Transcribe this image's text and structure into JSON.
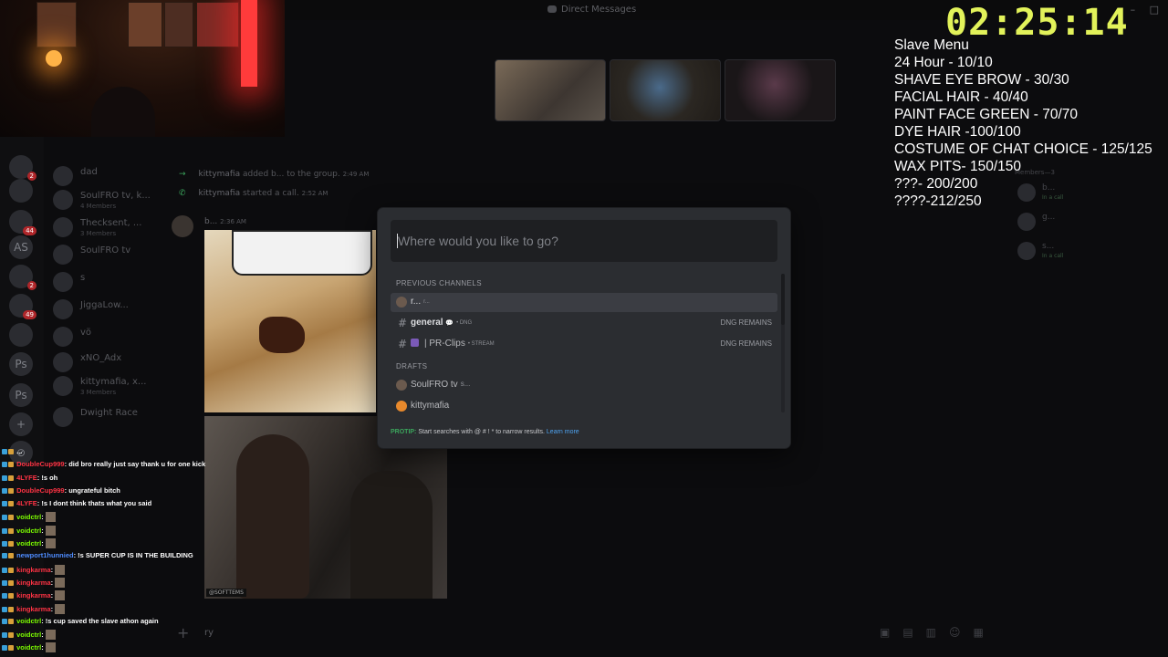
{
  "window": {
    "title": "Direct Messages",
    "controls": [
      "–",
      "□"
    ]
  },
  "timer": {
    "text": "02:25:14",
    "color": "#e2f25a"
  },
  "slave_menu": {
    "title": "Slave Menu",
    "items": [
      "24 Hour - 10/10",
      "SHAVE EYE BROW - 30/30",
      "FACIAL HAIR - 40/40",
      "PAINT FACE GREEN - 70/70",
      "DYE HAIR -100/100",
      "COSTUME OF CHAT CHOICE - 125/125",
      "WAX PITS- 150/150",
      "???- 200/200",
      "????-212/250"
    ]
  },
  "servers": [
    {
      "label": "",
      "badge": "2"
    },
    {
      "label": "",
      "badge": ""
    },
    {
      "label": "",
      "badge": "44"
    },
    {
      "label": "AS",
      "badge": ""
    },
    {
      "label": "",
      "badge": "2"
    },
    {
      "label": "",
      "badge": "49"
    },
    {
      "label": "",
      "badge": ""
    },
    {
      "label": "Ps",
      "badge": ""
    },
    {
      "label": "Ps",
      "badge": ""
    },
    {
      "label": "+",
      "badge": ""
    },
    {
      "label": "⊘",
      "badge": ""
    }
  ],
  "dm_list": [
    {
      "name": "dad",
      "sub": ""
    },
    {
      "name": "SoulFRO tv, k...",
      "sub": "4 Members"
    },
    {
      "name": "Thecksent, ...",
      "sub": "3 Members"
    },
    {
      "name": "SoulFRO tv",
      "sub": ""
    },
    {
      "name": "s",
      "sub": ""
    },
    {
      "name": "JiggaLow...",
      "sub": ""
    },
    {
      "name": "vö",
      "sub": ""
    },
    {
      "name": "xNO_Adx",
      "sub": ""
    },
    {
      "name": "kittymafia, x...",
      "sub": "3 Members"
    },
    {
      "name": "Dwight Race",
      "sub": ""
    }
  ],
  "system_messages": [
    {
      "user": "kittymafia",
      "text": "added b... to the group.",
      "time": "2:49 AM"
    },
    {
      "user": "kittymafia",
      "text": "started a call.",
      "time": "2:52 AM"
    }
  ],
  "message_header": {
    "user": "b...",
    "time": "2:36 AM"
  },
  "quick_switcher": {
    "placeholder": "Where would you like to go?",
    "previous_channels_label": "PREVIOUS CHANNELS",
    "drafts_label": "DRAFTS",
    "previous": [
      {
        "name": "r...",
        "meta": "r...",
        "right": "",
        "kind": "dm",
        "selected": true
      },
      {
        "name": "general",
        "meta": "• DNG",
        "right": "DNG REMAINS",
        "kind": "channel",
        "selected": false
      },
      {
        "name": "| PR-Clips",
        "meta": "• STREAM",
        "right": "DNG REMAINS",
        "kind": "channel",
        "selected": false
      }
    ],
    "drafts": [
      {
        "name": "SoulFRO tv",
        "meta": "s...",
        "kind": "dm"
      },
      {
        "name": "kittymafia",
        "meta": "",
        "kind": "dm"
      }
    ],
    "protip": {
      "label": "PROTIP:",
      "text": "Start searches with @ # ! * to narrow results.",
      "link": "Learn more"
    }
  },
  "members": {
    "header": "Members—3",
    "list": [
      {
        "name": "b...",
        "status": "In a call"
      },
      {
        "name": "g...",
        "status": ""
      },
      {
        "name": "s...",
        "status": "In a call"
      }
    ]
  },
  "media_tag": "@SOFTTEMS",
  "chat": [
    {
      "user": "",
      "color": "#ffffff",
      "msg": "...",
      "emote": false
    },
    {
      "user": "DoubleCup999",
      "color": "#ff3344",
      "msg": ": did bro really just say thank u for one kick",
      "emote": false
    },
    {
      "user": "4LYFE",
      "color": "#ff3344",
      "msg": ": !s oh",
      "emote": false
    },
    {
      "user": "DoubleCup999",
      "color": "#ff3344",
      "msg": ": ungrateful bitch",
      "emote": false
    },
    {
      "user": "4LYFE",
      "color": "#ff3344",
      "msg": ": !s I dont think thats what you said",
      "emote": false
    },
    {
      "user": "voidctrl",
      "color": "#7cfc00",
      "msg": ":",
      "emote": true
    },
    {
      "user": "voidctrl",
      "color": "#7cfc00",
      "msg": ":",
      "emote": true
    },
    {
      "user": "voidctrl",
      "color": "#7cfc00",
      "msg": ":",
      "emote": true
    },
    {
      "user": "newport1hunnied",
      "color": "#4e8cff",
      "msg": ": !s SUPER CUP IS IN THE BUILDING",
      "emote": false
    },
    {
      "user": "kingkarma",
      "color": "#ff3344",
      "msg": ":",
      "emote": true
    },
    {
      "user": "kingkarma",
      "color": "#ff3344",
      "msg": ":",
      "emote": true
    },
    {
      "user": "kingkarma",
      "color": "#ff3344",
      "msg": ":",
      "emote": true
    },
    {
      "user": "kingkarma",
      "color": "#ff3344",
      "msg": ":",
      "emote": true
    },
    {
      "user": "voidctrl",
      "color": "#7cfc00",
      "msg": ": !s cup saved the slave athon again",
      "emote": false
    },
    {
      "user": "voidctrl",
      "color": "#7cfc00",
      "msg": ":",
      "emote": true
    },
    {
      "user": "voidctrl",
      "color": "#7cfc00",
      "msg": ":",
      "emote": true
    }
  ],
  "composer_text": "ry"
}
